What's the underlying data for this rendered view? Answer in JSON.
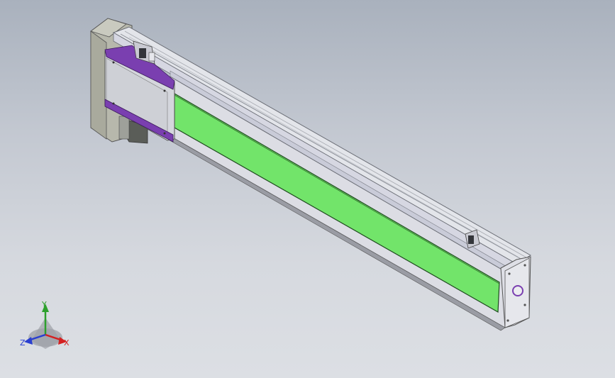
{
  "viewport": {
    "background_top": "#a9b1bd",
    "background_bottom": "#dcdfe4"
  },
  "model": {
    "accent_color": "#7a3fb0",
    "slot_cover_color": "#72e46a",
    "frame_color": "#d9dbe2",
    "end_plate_color": "#b9b9ad"
  },
  "triad": {
    "x_label": "X",
    "y_label": "Y",
    "z_label": "Z",
    "x_color": "#d42020",
    "y_color": "#2da02d",
    "z_color": "#2a3fd0"
  }
}
